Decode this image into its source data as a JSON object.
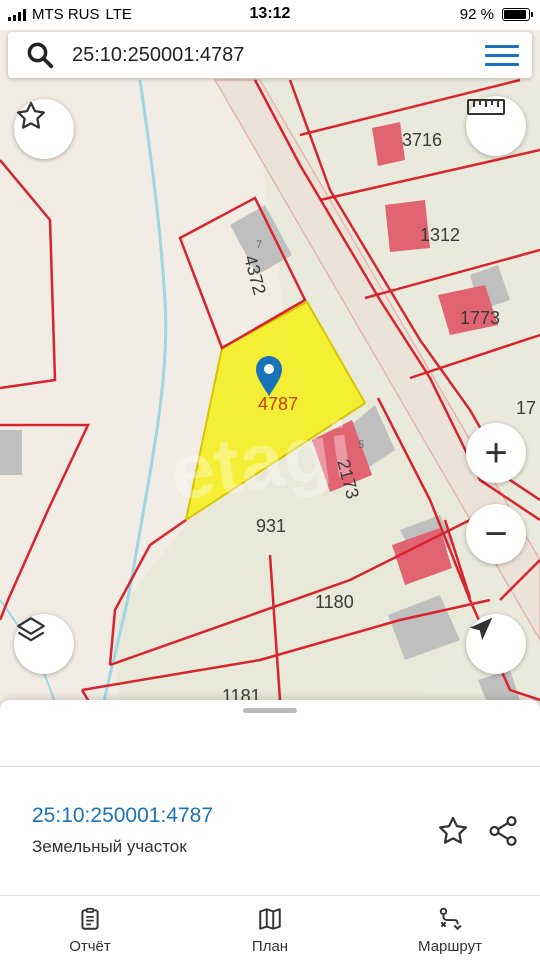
{
  "status_bar": {
    "carrier": "MTS RUS",
    "network": "LTE",
    "time": "13:12",
    "battery": "92 %",
    "battery_level": 0.92
  },
  "search": {
    "query": "25:10:250001:4787",
    "search_icon": "search-icon",
    "menu_icon": "hamburger-menu-icon"
  },
  "map": {
    "plot_labels": [
      "3716",
      "1312",
      "4372",
      "1773",
      "4787",
      "2173",
      "931",
      "1180",
      "1181",
      "17"
    ],
    "house_numbers": [
      "7",
      "5"
    ],
    "watermark": "etagi",
    "selected_plot": "4787",
    "colors": {
      "background": "#f1ece4",
      "boundary": "#d9232e",
      "building": "#e06472",
      "selected_fill": "#f4f020",
      "pin": "#1a73b8",
      "water": "#9fd6e6"
    },
    "controls": {
      "favorite_icon": "star-icon",
      "ruler_icon": "ruler-icon",
      "zoom_in": "+",
      "zoom_out": "−",
      "layers_icon": "layers-icon",
      "location_icon": "navigation-arrow-icon"
    }
  },
  "sheet": {
    "cadastral_number": "25:10:250001:4787",
    "property_type": "Земельный участок",
    "tabs": [
      {
        "label": "Отчёт",
        "icon": "report-clipboard-icon"
      },
      {
        "label": "План",
        "icon": "map-plan-icon"
      },
      {
        "label": "Маршрут",
        "icon": "route-icon"
      }
    ]
  }
}
